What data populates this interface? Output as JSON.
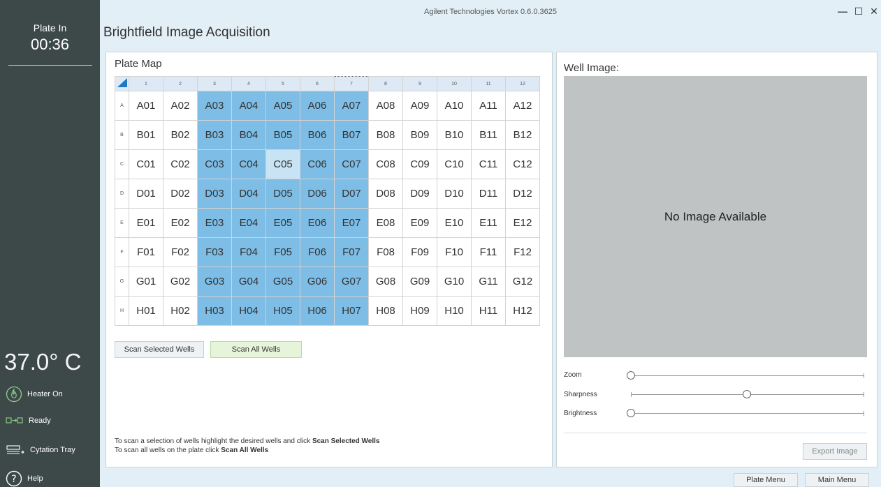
{
  "app_title": "Agilent Technologies Vortex 0.6.0.3625",
  "page_title": "Brightfield Image Acquisition",
  "window_controls": {
    "minimize": "—",
    "maximize": "☐",
    "close": "✕"
  },
  "sidebar": {
    "plate_label": "Plate In",
    "timer": "00:36",
    "temperature": "37.0° C",
    "heater": "Heater On",
    "status": "Ready",
    "tray": "Cytation Tray",
    "help": "Help"
  },
  "plate_map": {
    "title": "Plate Map",
    "columns": [
      "1",
      "2",
      "3",
      "4",
      "5",
      "6",
      "7",
      "8",
      "9",
      "10",
      "11",
      "12"
    ],
    "rows": [
      "A",
      "B",
      "C",
      "D",
      "E",
      "F",
      "G",
      "H"
    ],
    "active_column": "7",
    "selected_columns": [
      "3",
      "4",
      "5",
      "6",
      "7"
    ],
    "focused_well": "C05",
    "wells": [
      [
        "A01",
        "A02",
        "A03",
        "A04",
        "A05",
        "A06",
        "A07",
        "A08",
        "A09",
        "A10",
        "A11",
        "A12"
      ],
      [
        "B01",
        "B02",
        "B03",
        "B04",
        "B05",
        "B06",
        "B07",
        "B08",
        "B09",
        "B10",
        "B11",
        "B12"
      ],
      [
        "C01",
        "C02",
        "C03",
        "C04",
        "C05",
        "C06",
        "C07",
        "C08",
        "C09",
        "C10",
        "C11",
        "C12"
      ],
      [
        "D01",
        "D02",
        "D03",
        "D04",
        "D05",
        "D06",
        "D07",
        "D08",
        "D09",
        "D10",
        "D11",
        "D12"
      ],
      [
        "E01",
        "E02",
        "E03",
        "E04",
        "E05",
        "E06",
        "E07",
        "E08",
        "E09",
        "E10",
        "E11",
        "E12"
      ],
      [
        "F01",
        "F02",
        "F03",
        "F04",
        "F05",
        "F06",
        "F07",
        "F08",
        "F09",
        "F10",
        "F11",
        "F12"
      ],
      [
        "G01",
        "G02",
        "G03",
        "G04",
        "G05",
        "G06",
        "G07",
        "G08",
        "G09",
        "G10",
        "G11",
        "G12"
      ],
      [
        "H01",
        "H02",
        "H03",
        "H04",
        "H05",
        "H06",
        "H07",
        "H08",
        "H09",
        "H10",
        "H11",
        "H12"
      ]
    ]
  },
  "buttons": {
    "scan_selected": "Scan Selected Wells",
    "scan_all": "Scan All Wells",
    "export_image": "Export Image",
    "plate_menu": "Plate Menu",
    "main_menu": "Main Menu"
  },
  "instructions": {
    "line1_prefix": "To scan a selection of wells highlight the desired wells and click ",
    "line1_bold": "Scan Selected Wells",
    "line2_prefix": "To scan all wells on the plate click ",
    "line2_bold": "Scan All Wells"
  },
  "well_image": {
    "title": "Well Image:",
    "placeholder": "No Image Available"
  },
  "sliders": [
    {
      "label": "Zoom",
      "value": 0.0
    },
    {
      "label": "Sharpness",
      "value": 0.5
    },
    {
      "label": "Brightness",
      "value": 0.0
    }
  ],
  "colors": {
    "sidebar_bg": "#3d4849",
    "header_bg": "#e3eff6",
    "selected_well": "#7dbde6",
    "focused_well": "#c8e3f3",
    "scan_all_bg": "#e6f4d9"
  }
}
